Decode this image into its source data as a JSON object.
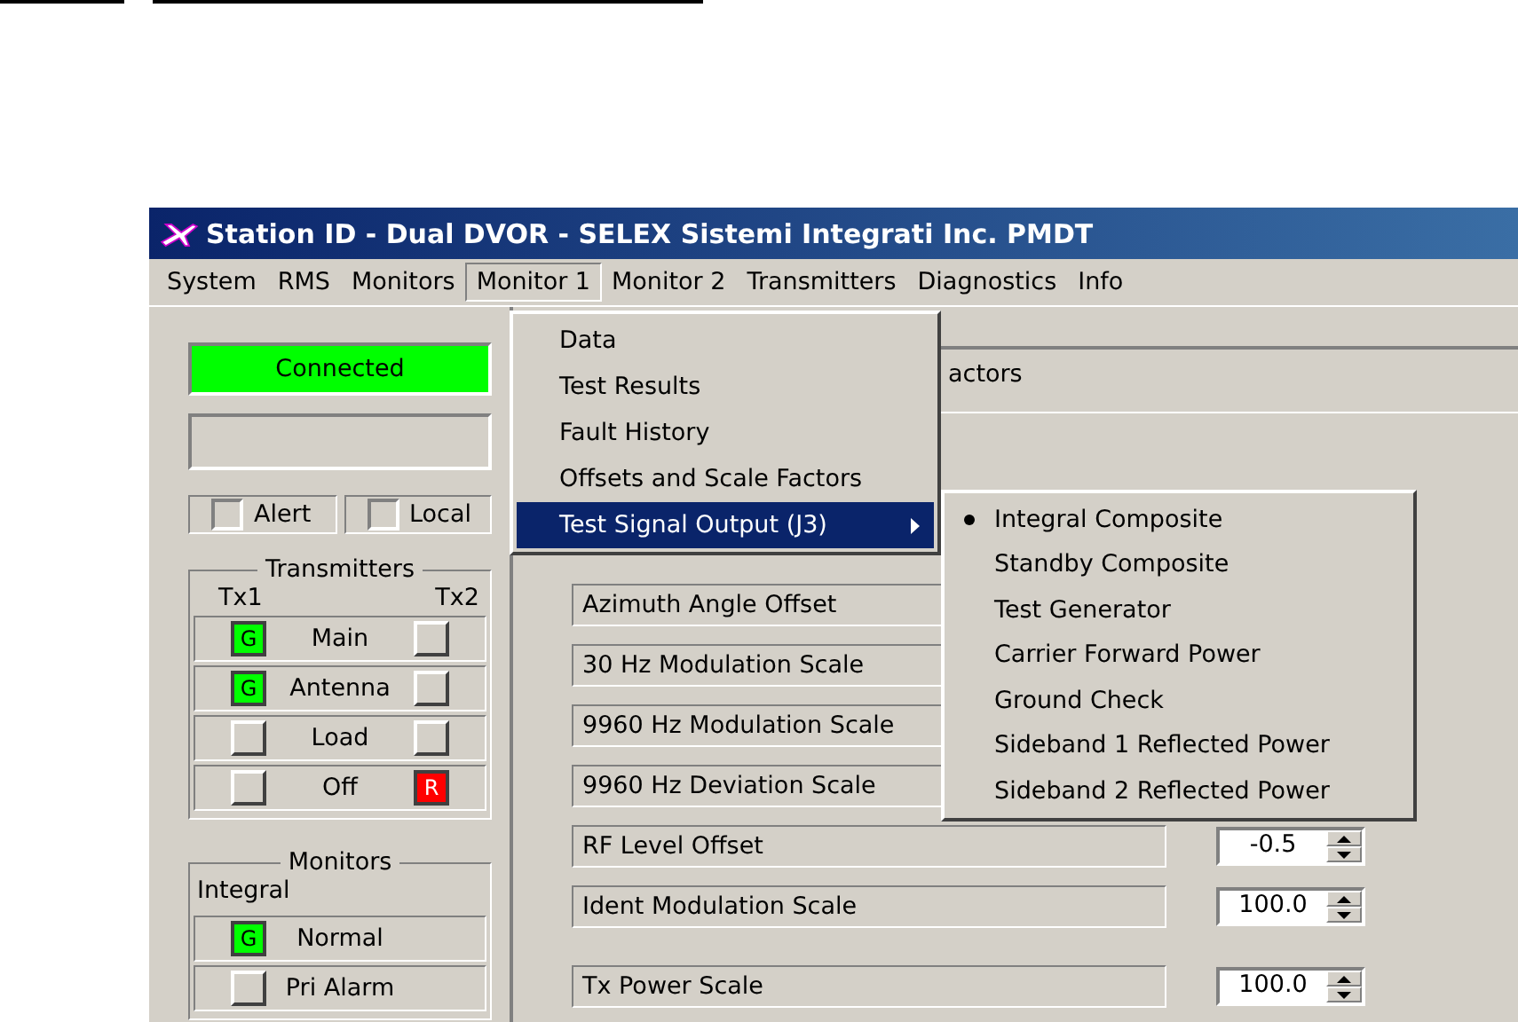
{
  "window": {
    "title": "Station ID - Dual DVOR - SELEX Sistemi Integrati Inc. PMDT"
  },
  "menubar": [
    {
      "label": "System",
      "selected": false
    },
    {
      "label": "RMS",
      "selected": false
    },
    {
      "label": "Monitors",
      "selected": false
    },
    {
      "label": "Monitor 1",
      "selected": true
    },
    {
      "label": "Monitor 2",
      "selected": false
    },
    {
      "label": "Transmitters",
      "selected": false
    },
    {
      "label": "Diagnostics",
      "selected": false
    },
    {
      "label": "Info",
      "selected": false
    }
  ],
  "status": {
    "label": "Connected",
    "connected": true
  },
  "indicators": [
    {
      "label": "Alert",
      "on": false
    },
    {
      "label": "Local",
      "on": false
    }
  ],
  "transmitters": {
    "title": "Transmitters",
    "tx1_label": "Tx1",
    "tx2_label": "Tx2",
    "rows": [
      {
        "label": "Main",
        "tx1": {
          "lit": true,
          "text": "G",
          "color": "#00ff00"
        },
        "tx2": {
          "lit": false
        }
      },
      {
        "label": "Antenna",
        "tx1": {
          "lit": true,
          "text": "G",
          "color": "#00ff00"
        },
        "tx2": {
          "lit": false
        }
      },
      {
        "label": "Load",
        "tx1": {
          "lit": false
        },
        "tx2": {
          "lit": false
        }
      },
      {
        "label": "Off",
        "tx1": {
          "lit": false
        },
        "tx2": {
          "lit": true,
          "text": "R",
          "color": "#ff0000"
        }
      }
    ]
  },
  "monitors": {
    "title": "Monitors",
    "subtitle": "Integral",
    "rows": [
      {
        "label": "Normal",
        "lamp": {
          "lit": true,
          "text": "G",
          "color": "#00ff00"
        }
      },
      {
        "label": "Pri Alarm",
        "lamp": {
          "lit": false
        }
      }
    ]
  },
  "panel": {
    "heading": "actors",
    "rows": [
      {
        "label": "Azimuth Angle Offset"
      },
      {
        "label": "30 Hz Modulation Scale"
      },
      {
        "label": "9960 Hz Modulation Scale"
      },
      {
        "label": "9960 Hz Deviation Scale"
      },
      {
        "label": "RF Level Offset",
        "value": "-0.5"
      },
      {
        "label": "Ident Modulation Scale",
        "value": "100.0"
      },
      {
        "label": "Tx Power Scale",
        "value": "100.0",
        "gap_before": true
      }
    ]
  },
  "menu": [
    {
      "label": "Data",
      "selected": false,
      "submenu": false
    },
    {
      "label": "Test Results",
      "selected": false,
      "submenu": false
    },
    {
      "label": "Fault History",
      "selected": false,
      "submenu": false
    },
    {
      "label": "Offsets and Scale Factors",
      "selected": false,
      "submenu": false
    },
    {
      "label": "Test Signal Output (J3)",
      "selected": true,
      "submenu": true
    }
  ],
  "submenu": [
    {
      "label": "Integral Composite",
      "checked": true
    },
    {
      "label": "Standby Composite",
      "checked": false
    },
    {
      "label": "Test Generator",
      "checked": false
    },
    {
      "label": "Carrier Forward Power",
      "checked": false
    },
    {
      "label": "Ground Check",
      "checked": false
    },
    {
      "label": "Sideband 1 Reflected Power",
      "checked": false
    },
    {
      "label": "Sideband 2 Reflected Power",
      "checked": false
    }
  ]
}
